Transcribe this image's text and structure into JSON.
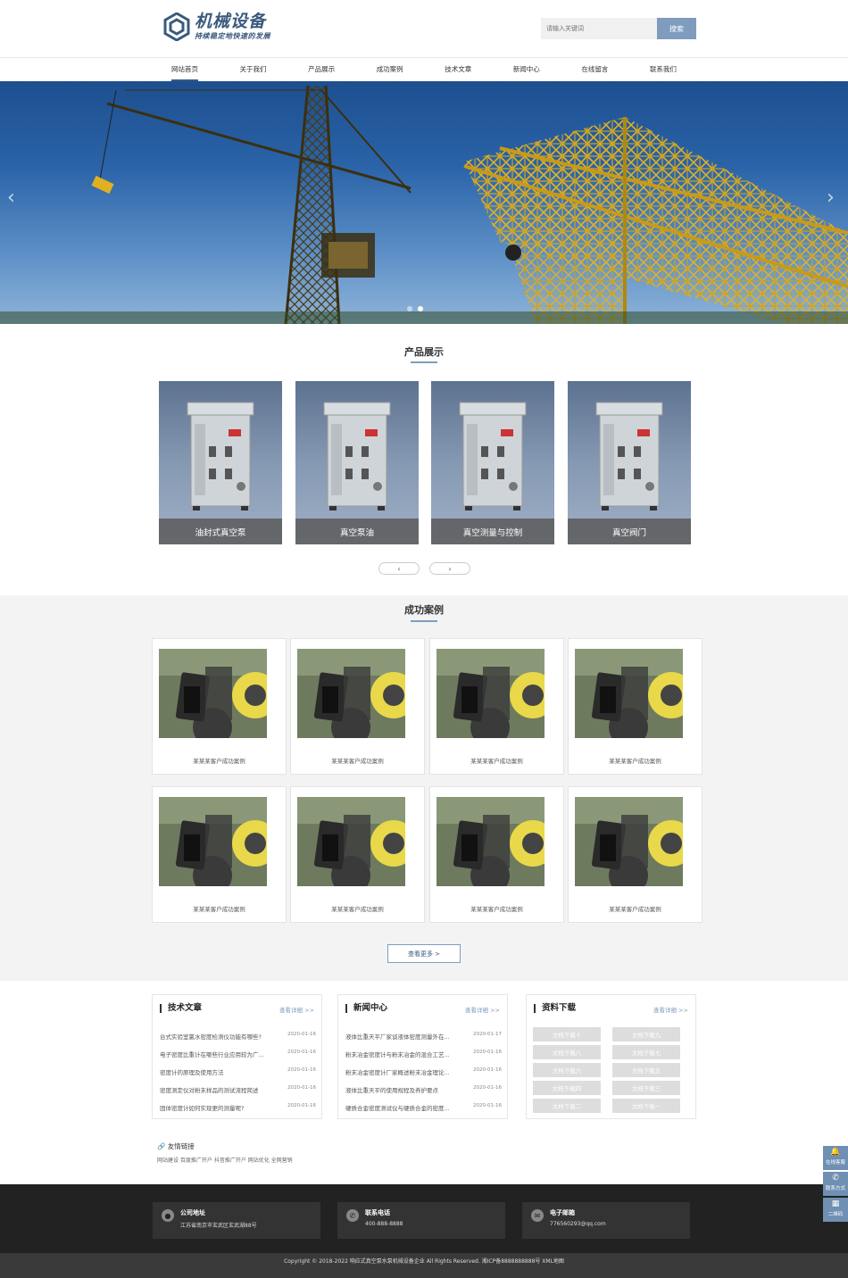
{
  "header": {
    "logo_title": "机械设备",
    "logo_sub": "持续稳定地快速的发展",
    "search_placeholder": "请输入关键词",
    "search_btn": "搜索"
  },
  "nav": [
    "网站首页",
    "关于我们",
    "产品展示",
    "成功案例",
    "技术文章",
    "新闻中心",
    "在线留言",
    "联系我们"
  ],
  "banner": {
    "prev": "‹",
    "next": "›"
  },
  "products": {
    "title": "产品展示",
    "items": [
      "油封式真空泵",
      "真空泵油",
      "真空测量与控制",
      "真空阀门"
    ],
    "prev": "‹",
    "next": "›"
  },
  "cases": {
    "title": "成功案例",
    "items": [
      "某某某客户成功案例",
      "某某某客户成功案例",
      "某某某客户成功案例",
      "某某某客户成功案例",
      "某某某客户成功案例",
      "某某某客户成功案例",
      "某某某客户成功案例",
      "某某某客户成功案例"
    ],
    "more": "查看更多 >"
  },
  "articles": {
    "title": "技术文章",
    "more": "查看详细 >>",
    "items": [
      {
        "t": "台式实验室氯水密度检测仪功能有哪些?",
        "d": "2020-01-16"
      },
      {
        "t": "电子密度比重计在哪些行业应用较为广...",
        "d": "2020-01-16"
      },
      {
        "t": "密度计的原理及使用方法",
        "d": "2020-01-16"
      },
      {
        "t": "密度测定仪对粉末样品的测试流程简述",
        "d": "2020-01-16"
      },
      {
        "t": "固体密度计如何实现更的测量呢?",
        "d": "2020-01-16"
      }
    ]
  },
  "news": {
    "title": "新闻中心",
    "more": "查看详细 >>",
    "items": [
      {
        "t": "液体比重天平厂家谈液体密度测量外在...",
        "d": "2020-01-17"
      },
      {
        "t": "粉末冶金密度计与粉末冶金的混合工艺...",
        "d": "2020-01-16"
      },
      {
        "t": "粉末冶金密度计厂家概述粉末冶金理论...",
        "d": "2020-01-16"
      },
      {
        "t": "液体比重天平的使用规程及养护要点",
        "d": "2020-01-16"
      },
      {
        "t": "硬质合金密度测试仪与硬质合金的密度...",
        "d": "2020-01-16"
      }
    ]
  },
  "downloads": {
    "title": "资料下载",
    "more": "查看详细 >>",
    "items": [
      "文档下载十",
      "文档下载九",
      "文档下载八",
      "文档下载七",
      "文档下载六",
      "文档下载五",
      "文档下载四",
      "文档下载三",
      "文档下载二",
      "文档下载一"
    ]
  },
  "links": {
    "title": "友情链接",
    "items": "网站建设 百度推广开户 抖音推广开户 网站优化 全网营销"
  },
  "footer": {
    "addr_label": "公司地址",
    "addr": "江苏省南京市玄武区玄武湖88号",
    "tel_label": "联系电话",
    "tel": "400-888-8888",
    "mail_label": "电子邮箱",
    "mail": "776560293@qq.com",
    "copyright": "Copyright © 2018-2022 响应式真空泵水泵机械设备企业 All Rights Reserved. 湘ICP备8888888888号 XML地图"
  },
  "side": [
    "在线客服",
    "联系方式",
    "二维码"
  ],
  "colors": {
    "accent": "#3a5a7c",
    "button": "#7f9cbe",
    "footer": "#222222"
  }
}
